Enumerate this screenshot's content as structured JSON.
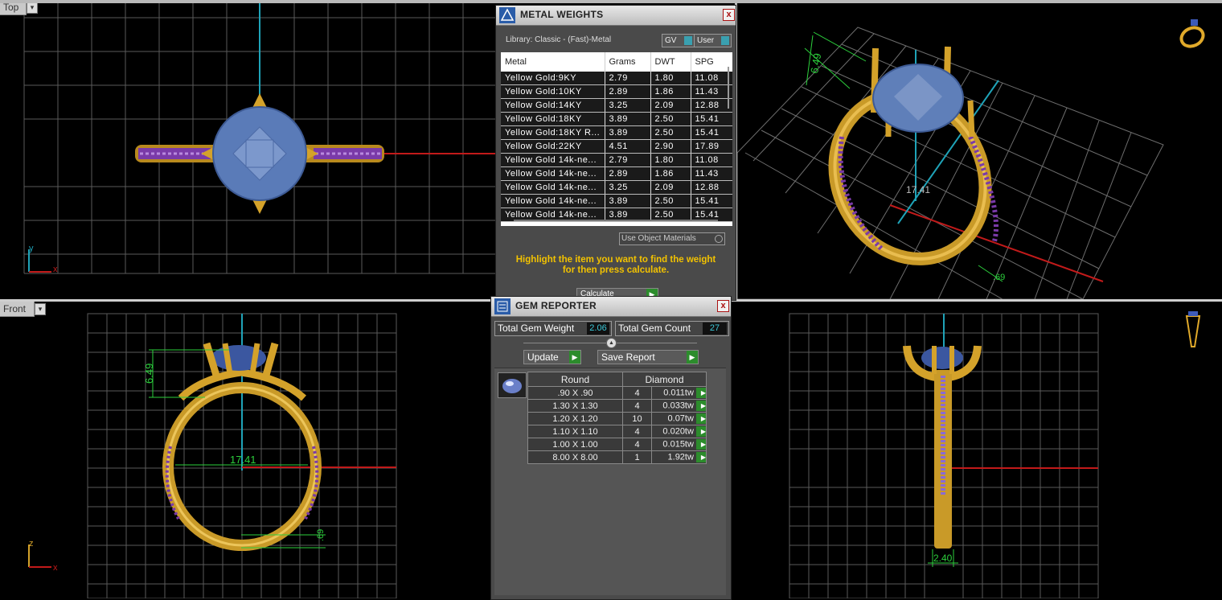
{
  "viewports": {
    "top": {
      "label": "Top",
      "dropdown": "▾",
      "axis_y": "y",
      "axis_x": "x"
    },
    "front": {
      "label": "Front",
      "dropdown": "▾",
      "axis_z": "z",
      "axis_x": "x",
      "dim_height": "6.49",
      "dim_width": "17.41",
      "dim_band": ".69"
    },
    "perspective": {
      "dim_height": "6.49",
      "dim_width": "17.41",
      "dim_band": ".69"
    },
    "right": {
      "dim_width": "2.40"
    }
  },
  "metal_weights": {
    "title": "METAL WEIGHTS",
    "close": "x",
    "library": "Library: Classic - (Fast)-Metal",
    "toggle_gv": "GV",
    "toggle_user": "User",
    "columns": [
      "Metal",
      "Grams",
      "DWT",
      "SPG"
    ],
    "rows": [
      [
        "Yellow Gold:9KY",
        "2.79",
        "1.80",
        "11.08"
      ],
      [
        "Yellow Gold:10KY",
        "2.89",
        "1.86",
        "11.43"
      ],
      [
        "Yellow Gold:14KY",
        "3.25",
        "2.09",
        "12.88"
      ],
      [
        "Yellow Gold:18KY",
        "3.89",
        "2.50",
        "15.41"
      ],
      [
        "Yellow Gold:18KY R...",
        "3.89",
        "2.50",
        "15.41"
      ],
      [
        "Yellow Gold:22KY",
        "4.51",
        "2.90",
        "17.89"
      ],
      [
        "Yellow Gold 14k-ne...",
        "2.79",
        "1.80",
        "11.08"
      ],
      [
        "Yellow Gold 14k-ne...",
        "2.89",
        "1.86",
        "11.43"
      ],
      [
        "Yellow Gold 14k-ne...",
        "3.25",
        "2.09",
        "12.88"
      ],
      [
        "Yellow Gold 14k-ne...",
        "3.89",
        "2.50",
        "15.41"
      ],
      [
        "Yellow Gold 14k-ne...",
        "3.89",
        "2.50",
        "15.41"
      ]
    ],
    "use_object_materials": "Use Object Materials",
    "instruction_line1": "Highlight the item you want to find the weight",
    "instruction_line2": "for then press calculate.",
    "calculate": "Calculate",
    "accent": "#f2c200"
  },
  "gem_reporter": {
    "title": "GEM REPORTER",
    "close": "x",
    "total_weight_label": "Total Gem Weight",
    "total_weight_value": "2.06",
    "total_count_label": "Total Gem Count",
    "total_count_value": "27",
    "update": "Update",
    "save_report": "Save Report",
    "col_shape": "Round",
    "col_type": "Diamond",
    "rows": [
      [
        ".90 X .90",
        "4",
        "0.011tw"
      ],
      [
        "1.30 X 1.30",
        "4",
        "0.033tw"
      ],
      [
        "1.20 X 1.20",
        "10",
        "0.07tw"
      ],
      [
        "1.10 X 1.10",
        "4",
        "0.020tw"
      ],
      [
        "1.00 X 1.00",
        "4",
        "0.015tw"
      ],
      [
        "8.00 X 8.00",
        "1",
        "1.92tw"
      ]
    ]
  }
}
